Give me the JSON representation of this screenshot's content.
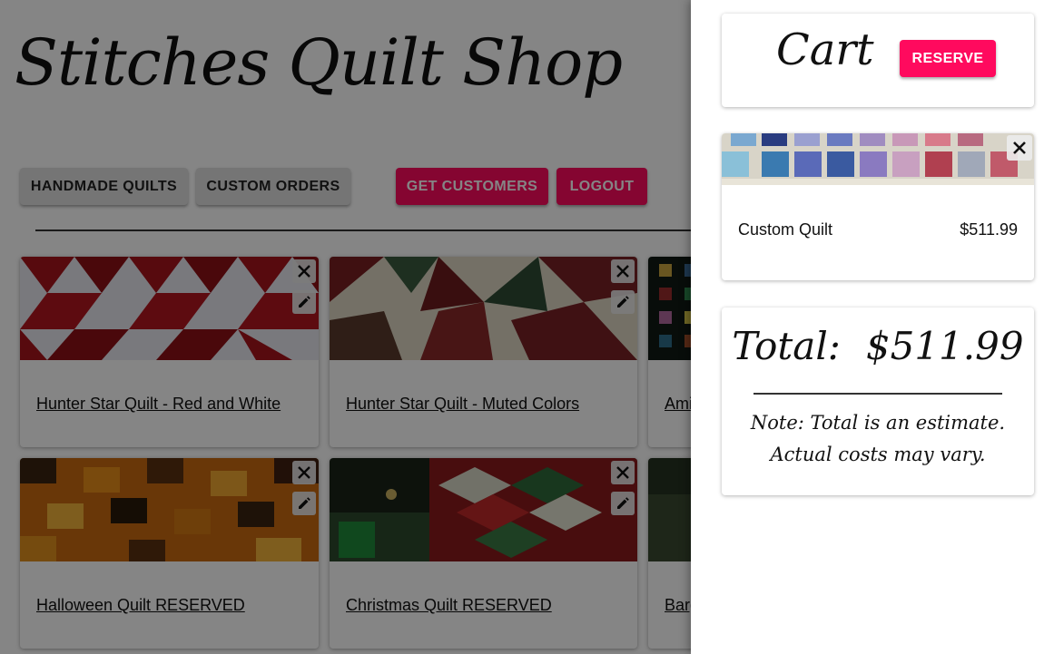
{
  "shop": {
    "title": "Stitches Quilt Shop"
  },
  "nav": {
    "handmade_quilts": "HANDMADE QUILTS",
    "custom_orders": "CUSTOM ORDERS",
    "get_customers": "GET CUSTOMERS",
    "logout": "LOGOUT"
  },
  "quilts": [
    {
      "title": "Hunter Star Quilt - Red and White"
    },
    {
      "title": "Hunter Star Quilt - Muted Colors"
    },
    {
      "title": "Ami"
    },
    {
      "title": "Halloween Quilt RESERVED"
    },
    {
      "title": "Christmas Quilt RESERVED"
    },
    {
      "title": "Barg"
    }
  ],
  "cart": {
    "title": "Cart",
    "reserve_label": "RESERVE",
    "items": [
      {
        "name": "Custom Quilt",
        "price": "$511.99"
      }
    ],
    "total_label": "Total:",
    "total_value": "$511.99",
    "note": "Note: Total is an estimate. Actual costs may vary."
  },
  "colors": {
    "accent": "#ff0a5e",
    "overlay": "rgba(0,0,0,0.48)"
  },
  "icons": {
    "delete": "close-icon",
    "edit": "pencil-icon"
  }
}
